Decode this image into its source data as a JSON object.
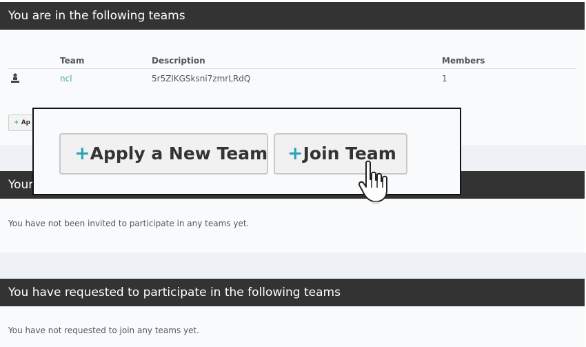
{
  "teams_panel": {
    "title": "You are in the following teams",
    "columns": [
      "Team",
      "Description",
      "Members"
    ],
    "rows": [
      {
        "icon": "owner-icon",
        "team": "ncl",
        "description": "5r5ZlKGSksni7zmrLRdQ",
        "members": "1"
      }
    ],
    "apply_button_small": "Ap"
  },
  "overlay": {
    "apply_button": "Apply a New Team",
    "join_button": "Join Team",
    "cursor": "hand-pointer-icon"
  },
  "invites_panel": {
    "title_visible": "Your",
    "message": "You have not been invited to participate in any teams yet."
  },
  "requests_panel": {
    "title": "You have requested to participate in the following teams",
    "message": "You have not requested to join any teams yet."
  },
  "colors": {
    "header_bg": "#333333",
    "accent": "#2aa3b8",
    "link": "#4aa6a6"
  }
}
